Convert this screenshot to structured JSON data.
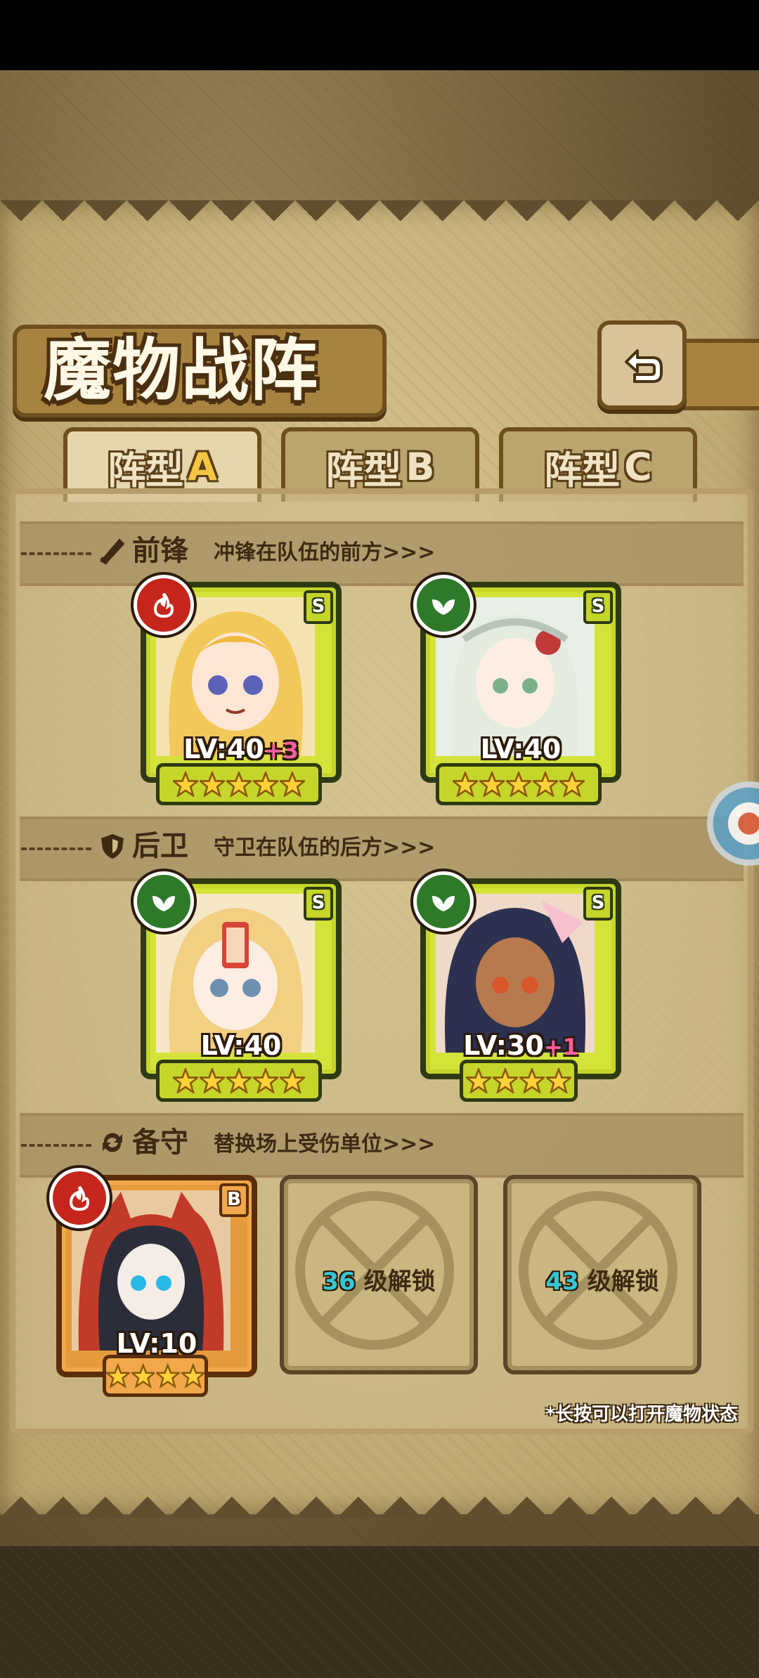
{
  "title": "魔物战阵",
  "tabs": [
    {
      "label": "阵型",
      "letter": "A",
      "active": true
    },
    {
      "label": "阵型",
      "letter": "B",
      "active": false
    },
    {
      "label": "阵型",
      "letter": "C",
      "active": false
    }
  ],
  "sections": {
    "front": {
      "label": "前锋",
      "desc": "冲锋在队伍的前方>>>"
    },
    "back": {
      "label": "后卫",
      "desc": "守卫在队伍的后方>>>"
    },
    "reserve": {
      "label": "备守",
      "desc": "替换场上受伤单位>>>"
    }
  },
  "units": [
    {
      "level": "LV:40",
      "bonus": "+3",
      "rank": "S",
      "element": "fire",
      "stars": 5
    },
    {
      "level": "LV:40",
      "bonus": "",
      "rank": "S",
      "element": "nature",
      "stars": 5
    },
    {
      "level": "LV:40",
      "bonus": "",
      "rank": "S",
      "element": "nature",
      "stars": 5
    },
    {
      "level": "LV:30",
      "bonus": "+1",
      "rank": "S",
      "element": "nature",
      "stars": 4
    },
    {
      "level": "LV:10",
      "bonus": "",
      "rank": "B",
      "element": "fire",
      "stars": 4
    }
  ],
  "locked_slots": [
    {
      "level": "36",
      "text": "级解锁"
    },
    {
      "level": "43",
      "text": "级解锁"
    }
  ],
  "hint": "*长按可以打开魔物状态",
  "colors": {
    "frame_gold": "#c6d52a",
    "frame_orange": "#f0a84a",
    "fire": "#c4261c",
    "nature": "#2f7a2a",
    "unlock_num": "#35c7d6"
  }
}
